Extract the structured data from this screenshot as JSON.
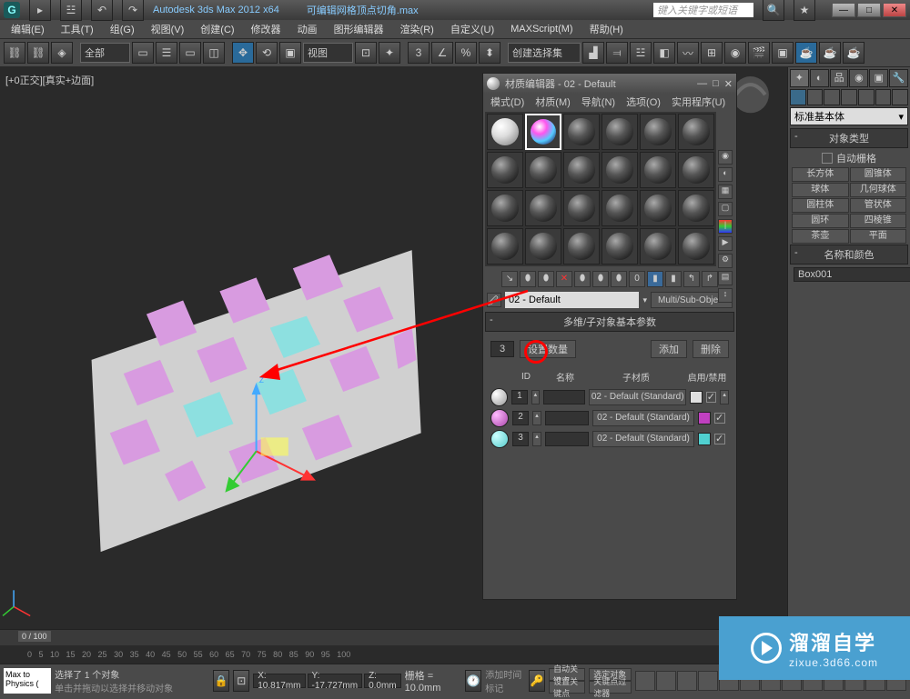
{
  "title": {
    "app": "Autodesk 3ds Max 2012 x64",
    "doc": "可编辑网格顶点切角.max",
    "search": "键入关键字或短语"
  },
  "menu": [
    "编辑(E)",
    "工具(T)",
    "组(G)",
    "视图(V)",
    "创建(C)",
    "修改器",
    "动画",
    "图形编辑器",
    "渲染(R)",
    "自定义(U)",
    "MAXScript(M)",
    "帮助(H)"
  ],
  "toolbar": {
    "scope": "全部",
    "view": "视图",
    "selset": "创建选择集"
  },
  "viewport": {
    "label": "[+0正交][真实+边面]"
  },
  "matEditor": {
    "title": "材质编辑器 - 02 - Default",
    "menu": [
      "模式(D)",
      "材质(M)",
      "导航(N)",
      "选项(O)",
      "实用程序(U)"
    ],
    "currentName": "02 - Default",
    "currentType": "Multi/Sub-Object",
    "rollout": "多维/子对象基本参数",
    "count": "3",
    "btnSetNum": "设置数量",
    "btnAdd": "添加",
    "btnDel": "删除",
    "headID": "ID",
    "headName": "名称",
    "headSub": "子材质",
    "headEnable": "启用/禁用",
    "subBtn": "02 - Default (Standard)",
    "subs": [
      {
        "id": "1",
        "color": "#e0e0e0"
      },
      {
        "id": "2",
        "color": "#c040c0"
      },
      {
        "id": "3",
        "color": "#50d0d0"
      }
    ]
  },
  "cmdPanel": {
    "dropdown": "标准基本体",
    "objType": "对象类型",
    "autoGrid": "自动栅格",
    "prims": [
      "长方体",
      "圆锥体",
      "球体",
      "几何球体",
      "圆柱体",
      "管状体",
      "圆环",
      "四棱锥",
      "茶壶",
      "平面"
    ],
    "nameColor": "名称和颜色",
    "objName": "Box001"
  },
  "status": {
    "maxscript": "Max to Physics (",
    "sel": "选择了 1 个对象",
    "hint": "单击并拖动以选择并移动对象",
    "addTime": "添加时间标记",
    "x": "X: 10.817mm",
    "y": "Y: -17.727mm",
    "z": "Z: 0.0mm",
    "grid": "栅格 = 10.0mm",
    "autokey": "自动关键点",
    "selkey": "选定对象",
    "setkey": "设置关键点",
    "keyfilt": "关键点过滤器",
    "frame": "0 / 100"
  },
  "watermark": {
    "big": "溜溜自学",
    "small": "zixue.3d66.com"
  }
}
